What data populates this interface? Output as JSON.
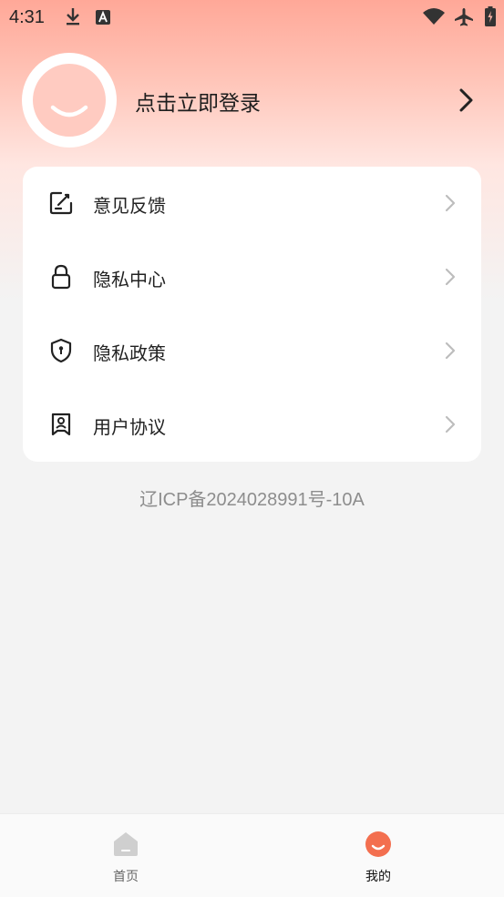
{
  "status_bar": {
    "time": "4:31",
    "icons": [
      "download-icon",
      "font-a-icon",
      "wifi-icon",
      "airplane-icon",
      "battery-icon"
    ]
  },
  "profile": {
    "login_prompt": "点击立即登录",
    "arrow_icon": "chevron-right-icon"
  },
  "menu": {
    "items": [
      {
        "label": "意见反馈",
        "icon": "feedback-edit-icon"
      },
      {
        "label": "隐私中心",
        "icon": "lock-icon"
      },
      {
        "label": "隐私政策",
        "icon": "shield-icon"
      },
      {
        "label": "用户协议",
        "icon": "user-agreement-icon"
      }
    ]
  },
  "footer": {
    "icp": "辽ICP备2024028991号-10A"
  },
  "tabbar": {
    "tabs": [
      {
        "label": "首页",
        "icon": "home-icon",
        "active": false
      },
      {
        "label": "我的",
        "icon": "smile-icon",
        "active": true
      }
    ]
  },
  "colors": {
    "accent": "#f36f4f",
    "header_gradient_top": "#ffa898",
    "avatar_face": "#ffcbc1",
    "inactive_tab": "#cfcfcf"
  }
}
